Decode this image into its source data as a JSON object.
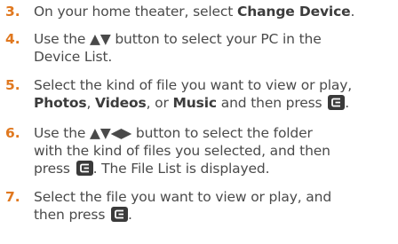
{
  "steps": [
    {
      "number": "3.",
      "line1_pre": "On your home theater, select ",
      "line1_bold": "Change Device",
      "line1_post": "."
    },
    {
      "number": "4.",
      "line1": "Use the ▲▼ button to select your PC in the",
      "line2": "Device List."
    },
    {
      "number": "5.",
      "line1": "Select the kind of file you want to view or play,",
      "photos": "Photos",
      "sep1": ", ",
      "videos": "Videos",
      "sep2": ", or ",
      "music": "Music",
      "line2_post": " and then press ",
      "line2_end": "."
    },
    {
      "number": "6.",
      "line1": "Use the ▲▼◀▶ button to select the folder",
      "line2": "with the kind of files you selected, and then",
      "line3_pre": "press ",
      "line3_post": ". The File List is displayed."
    },
    {
      "number": "7.",
      "line1": "Select the file you want to view or play, and",
      "line2_pre": "then press ",
      "line2_post": "."
    }
  ],
  "icons": {
    "enter": "enter-button-icon"
  },
  "colors": {
    "step_number": "#e0781f",
    "icon_fill": "#3a3a3a"
  }
}
